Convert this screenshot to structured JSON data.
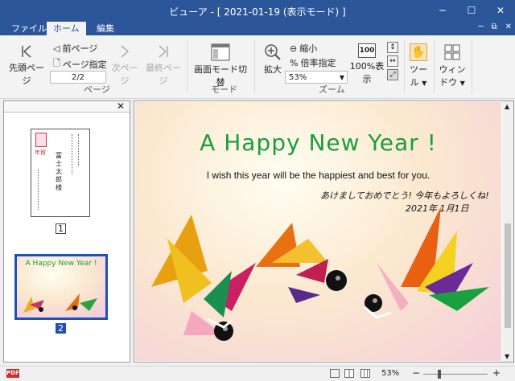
{
  "window": {
    "title": "ビューア - [ 2021-01-19 (表示モード) ]"
  },
  "menu": {
    "tabs": [
      "ファイル",
      "ホーム",
      "編集"
    ],
    "active": "ホーム"
  },
  "ribbon": {
    "page_group": {
      "label": "ページ",
      "first_page": "先頭ページ",
      "prev_page": "前ページ",
      "goto_page": "ページ指定",
      "page_value": "2/2",
      "next_page": "次ページ",
      "last_page": "最終ページ"
    },
    "mode_group": {
      "label": "モード",
      "screen_mode": "画面モード切替"
    },
    "zoom_group": {
      "label": "ズーム",
      "zoom_in": "拡大",
      "zoom_out": "縮小",
      "zoom_ratio": "倍率指定",
      "zoom_value": "53%",
      "zoom_100": "100%表示",
      "zoom_100_icon": "100"
    },
    "tools": {
      "label": "ツール"
    },
    "window": {
      "label": "ウィンドウ"
    }
  },
  "sidebar": {
    "pages": [
      {
        "label": "1"
      },
      {
        "label": "2"
      }
    ],
    "selected": 2,
    "thumb1": {
      "name": "冨士 太郎 様",
      "stamp": "年賀"
    },
    "thumb2": {
      "headline": "A Happy New Year !"
    }
  },
  "card": {
    "headline": "A Happy New Year !",
    "subtitle": "I wish this year will be the happiest and best for you.",
    "jp_line1": "あけましておめでとう! 今年もよろしくね!",
    "jp_line2": "2021年 1月1日"
  },
  "status": {
    "zoom": "53%",
    "pdf_label": "PDF"
  },
  "colors": {
    "accent": "#2b579a",
    "headline": "#1a9e3c",
    "selection": "#1f4fb8"
  }
}
